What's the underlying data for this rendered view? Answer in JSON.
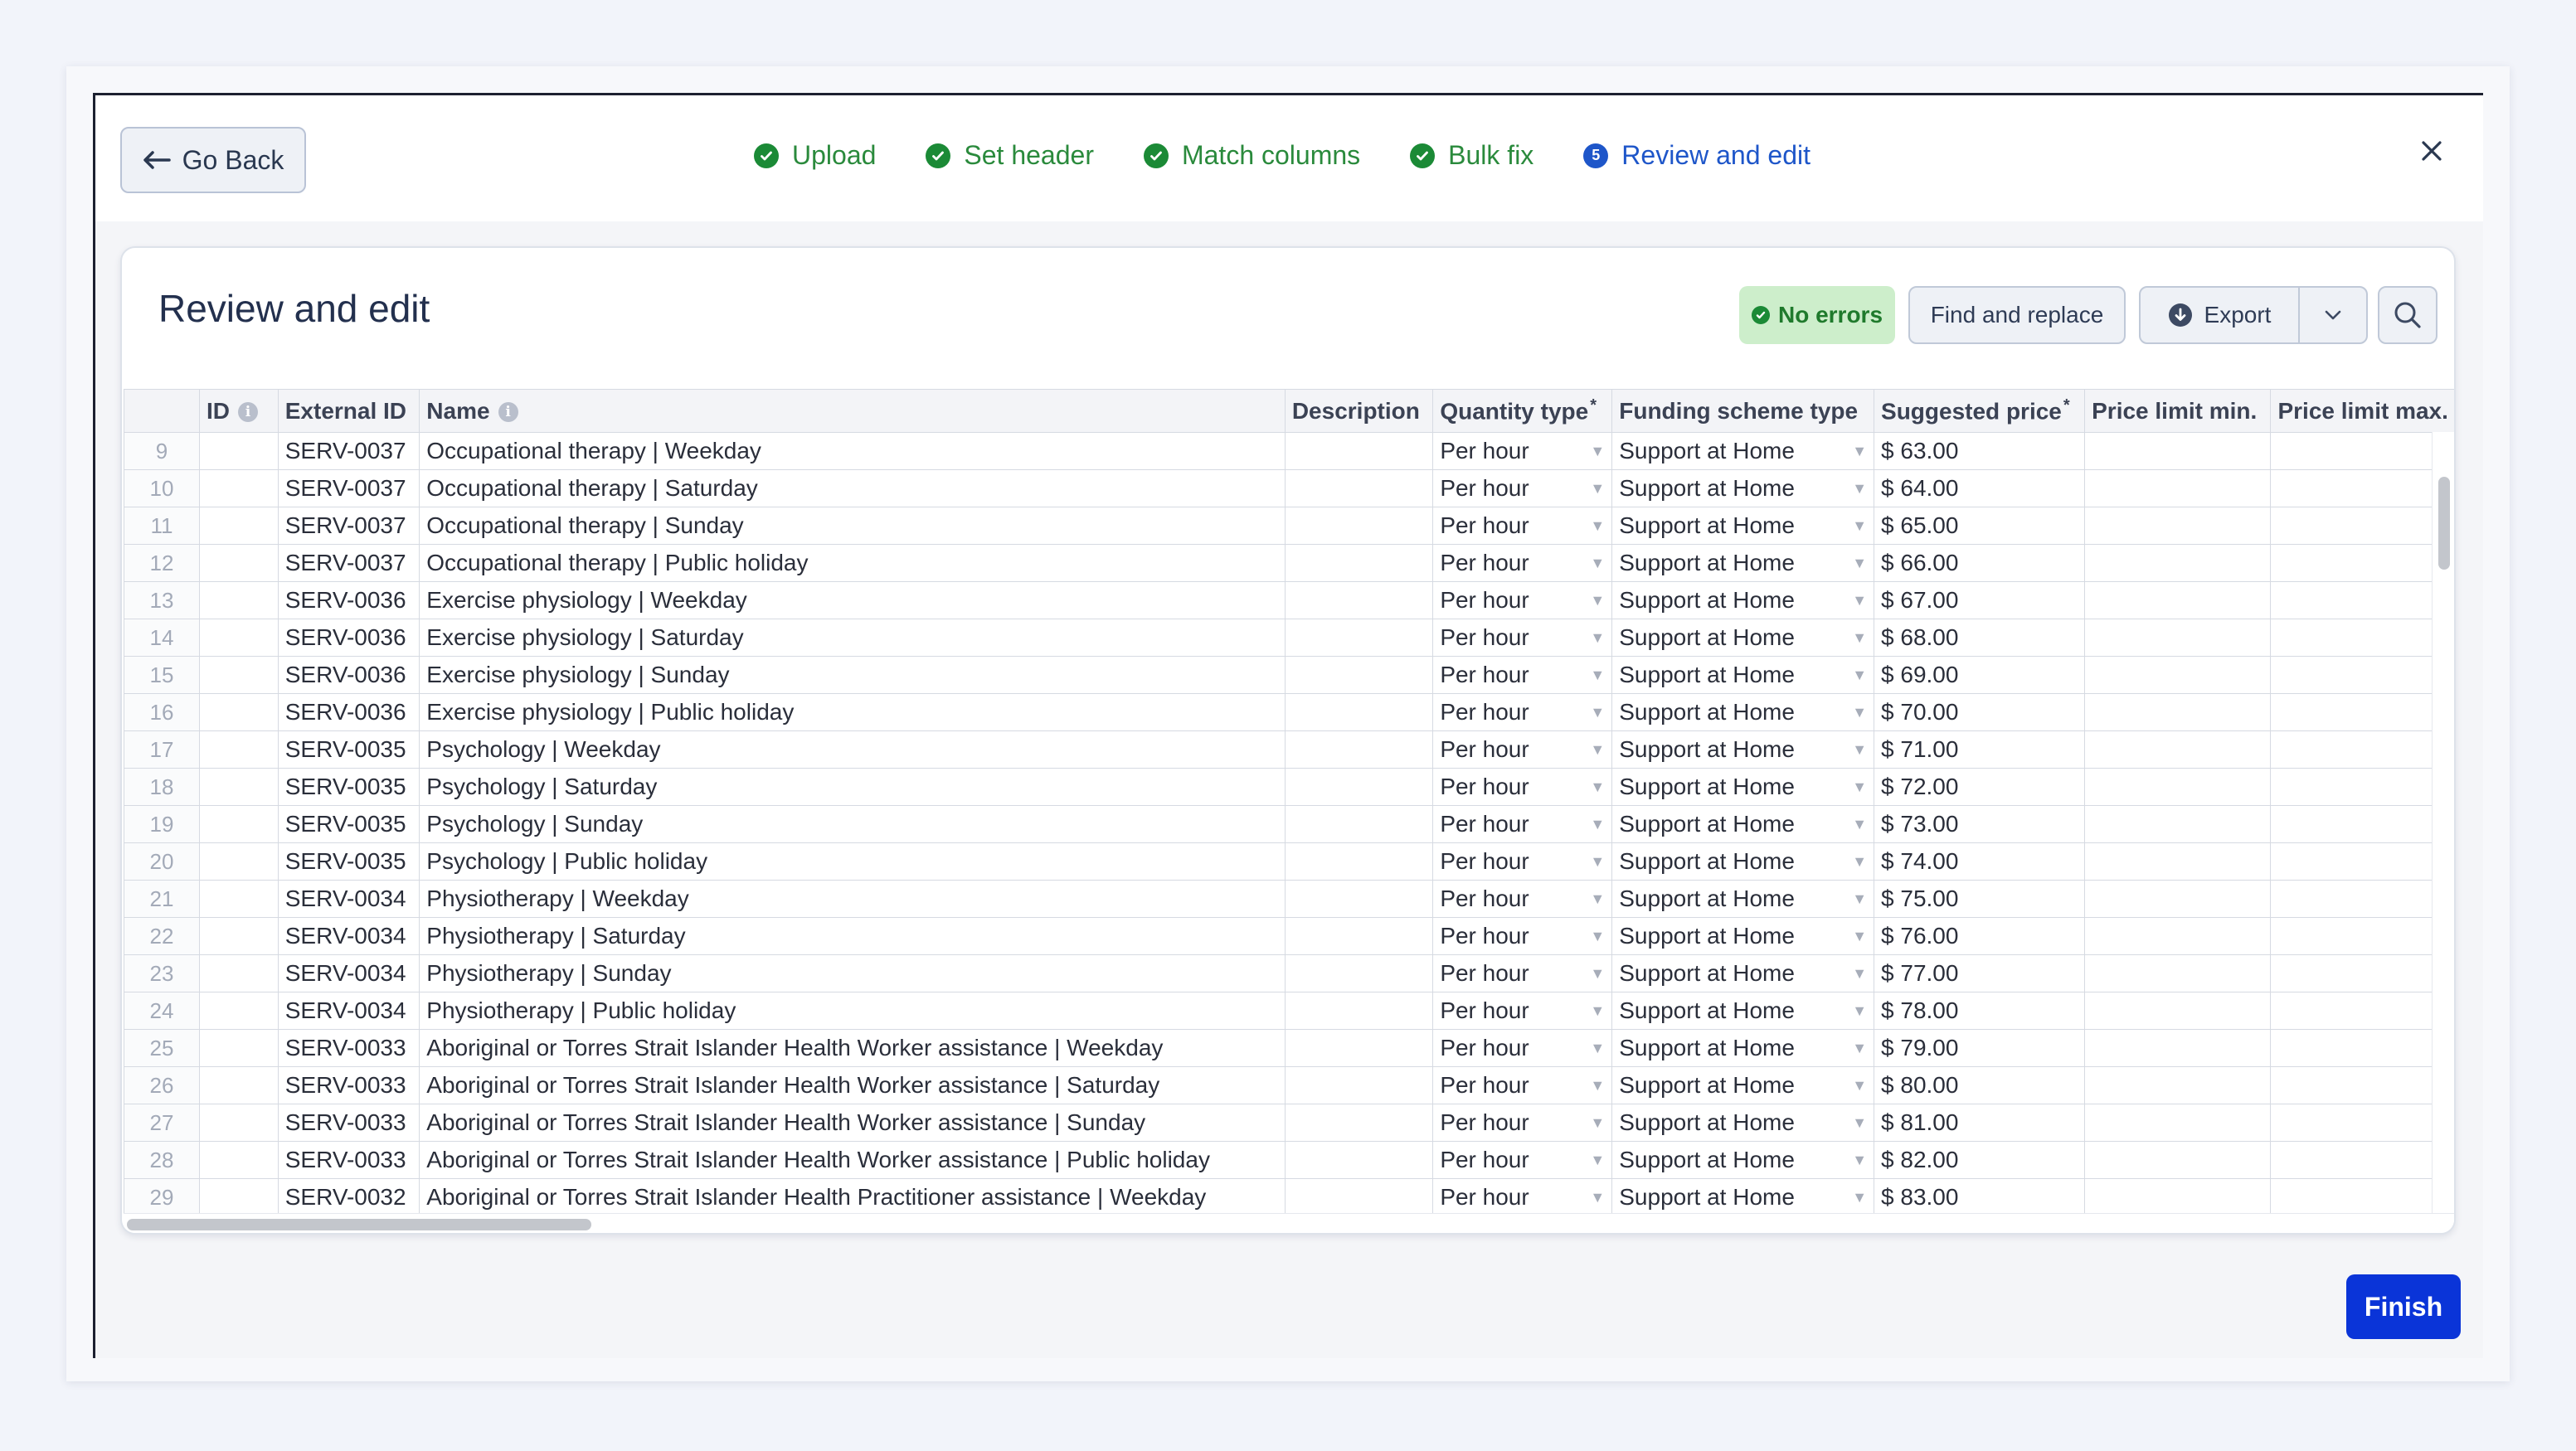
{
  "nav": {
    "go_back": "Go Back"
  },
  "steps": [
    {
      "label": "Upload",
      "status": "done"
    },
    {
      "label": "Set header",
      "status": "done"
    },
    {
      "label": "Match columns",
      "status": "done"
    },
    {
      "label": "Bulk fix",
      "status": "done"
    },
    {
      "label": "Review and edit",
      "status": "active",
      "number": "5"
    }
  ],
  "panel": {
    "title": "Review and edit",
    "errors_badge": "No errors",
    "find_replace": "Find and replace",
    "export": "Export"
  },
  "columns": {
    "id": "ID",
    "external_id": "External ID",
    "name": "Name",
    "description": "Description",
    "quantity_type": "Quantity type",
    "funding_scheme_type": "Funding scheme type",
    "suggested_price": "Suggested price",
    "price_limit_min": "Price limit min.",
    "price_limit_max": "Price limit max."
  },
  "rows": [
    {
      "n": "9",
      "ext": "SERV-0037",
      "name": "Occupational therapy | Weekday",
      "qty": "Per hour",
      "fund": "Support at Home",
      "price": "$ 63.00"
    },
    {
      "n": "10",
      "ext": "SERV-0037",
      "name": "Occupational therapy | Saturday",
      "qty": "Per hour",
      "fund": "Support at Home",
      "price": "$ 64.00"
    },
    {
      "n": "11",
      "ext": "SERV-0037",
      "name": "Occupational therapy | Sunday",
      "qty": "Per hour",
      "fund": "Support at Home",
      "price": "$ 65.00"
    },
    {
      "n": "12",
      "ext": "SERV-0037",
      "name": "Occupational therapy | Public holiday",
      "qty": "Per hour",
      "fund": "Support at Home",
      "price": "$ 66.00"
    },
    {
      "n": "13",
      "ext": "SERV-0036",
      "name": "Exercise physiology | Weekday",
      "qty": "Per hour",
      "fund": "Support at Home",
      "price": "$ 67.00"
    },
    {
      "n": "14",
      "ext": "SERV-0036",
      "name": "Exercise physiology | Saturday",
      "qty": "Per hour",
      "fund": "Support at Home",
      "price": "$ 68.00"
    },
    {
      "n": "15",
      "ext": "SERV-0036",
      "name": "Exercise physiology | Sunday",
      "qty": "Per hour",
      "fund": "Support at Home",
      "price": "$ 69.00"
    },
    {
      "n": "16",
      "ext": "SERV-0036",
      "name": "Exercise physiology | Public holiday",
      "qty": "Per hour",
      "fund": "Support at Home",
      "price": "$ 70.00"
    },
    {
      "n": "17",
      "ext": "SERV-0035",
      "name": "Psychology | Weekday",
      "qty": "Per hour",
      "fund": "Support at Home",
      "price": "$ 71.00"
    },
    {
      "n": "18",
      "ext": "SERV-0035",
      "name": "Psychology | Saturday",
      "qty": "Per hour",
      "fund": "Support at Home",
      "price": "$ 72.00"
    },
    {
      "n": "19",
      "ext": "SERV-0035",
      "name": "Psychology | Sunday",
      "qty": "Per hour",
      "fund": "Support at Home",
      "price": "$ 73.00"
    },
    {
      "n": "20",
      "ext": "SERV-0035",
      "name": "Psychology | Public holiday",
      "qty": "Per hour",
      "fund": "Support at Home",
      "price": "$ 74.00"
    },
    {
      "n": "21",
      "ext": "SERV-0034",
      "name": "Physiotherapy | Weekday",
      "qty": "Per hour",
      "fund": "Support at Home",
      "price": "$ 75.00"
    },
    {
      "n": "22",
      "ext": "SERV-0034",
      "name": "Physiotherapy | Saturday",
      "qty": "Per hour",
      "fund": "Support at Home",
      "price": "$ 76.00"
    },
    {
      "n": "23",
      "ext": "SERV-0034",
      "name": "Physiotherapy | Sunday",
      "qty": "Per hour",
      "fund": "Support at Home",
      "price": "$ 77.00"
    },
    {
      "n": "24",
      "ext": "SERV-0034",
      "name": "Physiotherapy | Public holiday",
      "qty": "Per hour",
      "fund": "Support at Home",
      "price": "$ 78.00"
    },
    {
      "n": "25",
      "ext": "SERV-0033",
      "name": "Aboriginal or Torres Strait Islander Health Worker assistance | Weekday",
      "qty": "Per hour",
      "fund": "Support at Home",
      "price": "$ 79.00"
    },
    {
      "n": "26",
      "ext": "SERV-0033",
      "name": "Aboriginal or Torres Strait Islander Health Worker assistance | Saturday",
      "qty": "Per hour",
      "fund": "Support at Home",
      "price": "$ 80.00"
    },
    {
      "n": "27",
      "ext": "SERV-0033",
      "name": "Aboriginal or Torres Strait Islander Health Worker assistance | Sunday",
      "qty": "Per hour",
      "fund": "Support at Home",
      "price": "$ 81.00"
    },
    {
      "n": "28",
      "ext": "SERV-0033",
      "name": "Aboriginal or Torres Strait Islander Health Worker assistance | Public holiday",
      "qty": "Per hour",
      "fund": "Support at Home",
      "price": "$ 82.00"
    },
    {
      "n": "29",
      "ext": "SERV-0032",
      "name": "Aboriginal or Torres Strait Islander Health Practitioner assistance | Weekday",
      "qty": "Per hour",
      "fund": "Support at Home",
      "price": "$ 83.00"
    }
  ],
  "footer": {
    "finish": "Finish"
  },
  "colors": {
    "success": "#1b8a36",
    "active": "#1e56c9",
    "primary": "#0a34d8"
  }
}
